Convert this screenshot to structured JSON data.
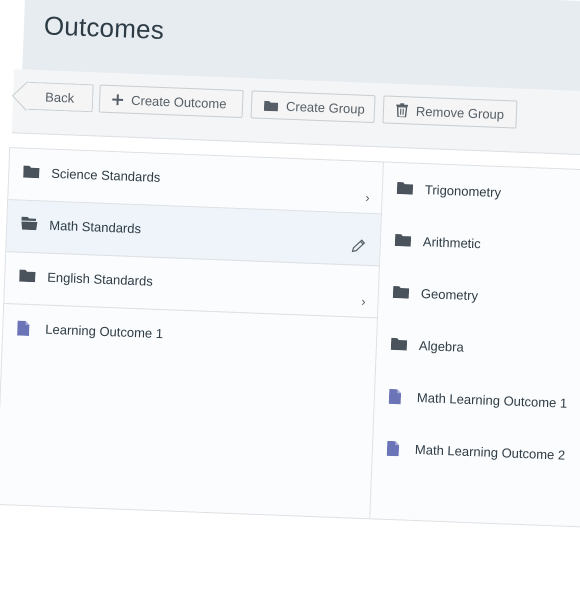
{
  "page": {
    "title": "Outcomes"
  },
  "toolbar": {
    "back_label": "Back",
    "create_outcome_label": "Create Outcome",
    "create_group_label": "Create Group",
    "remove_group_label": "Remove Group"
  },
  "left_column": {
    "items": [
      {
        "label": "Science Standards",
        "type": "folder",
        "has_children": true
      },
      {
        "label": "Math Standards",
        "type": "folder-open",
        "selected": true
      },
      {
        "label": "English Standards",
        "type": "folder",
        "has_children": true
      },
      {
        "label": "Learning Outcome 1",
        "type": "outcome"
      }
    ]
  },
  "right_column": {
    "items": [
      {
        "label": "Trigonometry",
        "type": "folder"
      },
      {
        "label": "Arithmetic",
        "type": "folder"
      },
      {
        "label": "Geometry",
        "type": "folder"
      },
      {
        "label": "Algebra",
        "type": "folder"
      },
      {
        "label": "Math Learning Outcome 1",
        "type": "outcome"
      },
      {
        "label": "Math Learning Outcome 2",
        "type": "outcome"
      }
    ]
  },
  "icons": {
    "folder": "folder-icon",
    "folder_open": "folder-open-icon",
    "outcome": "document-icon",
    "chevron": "chevron-right-icon",
    "edit": "pencil-icon",
    "plus": "plus-icon",
    "trash": "trash-icon"
  },
  "colors": {
    "header_bg": "#e7ecf1",
    "selected_row_bg": "#eef4fa",
    "folder_icon": "#4a535c",
    "outcome_icon": "#6c74b8"
  }
}
